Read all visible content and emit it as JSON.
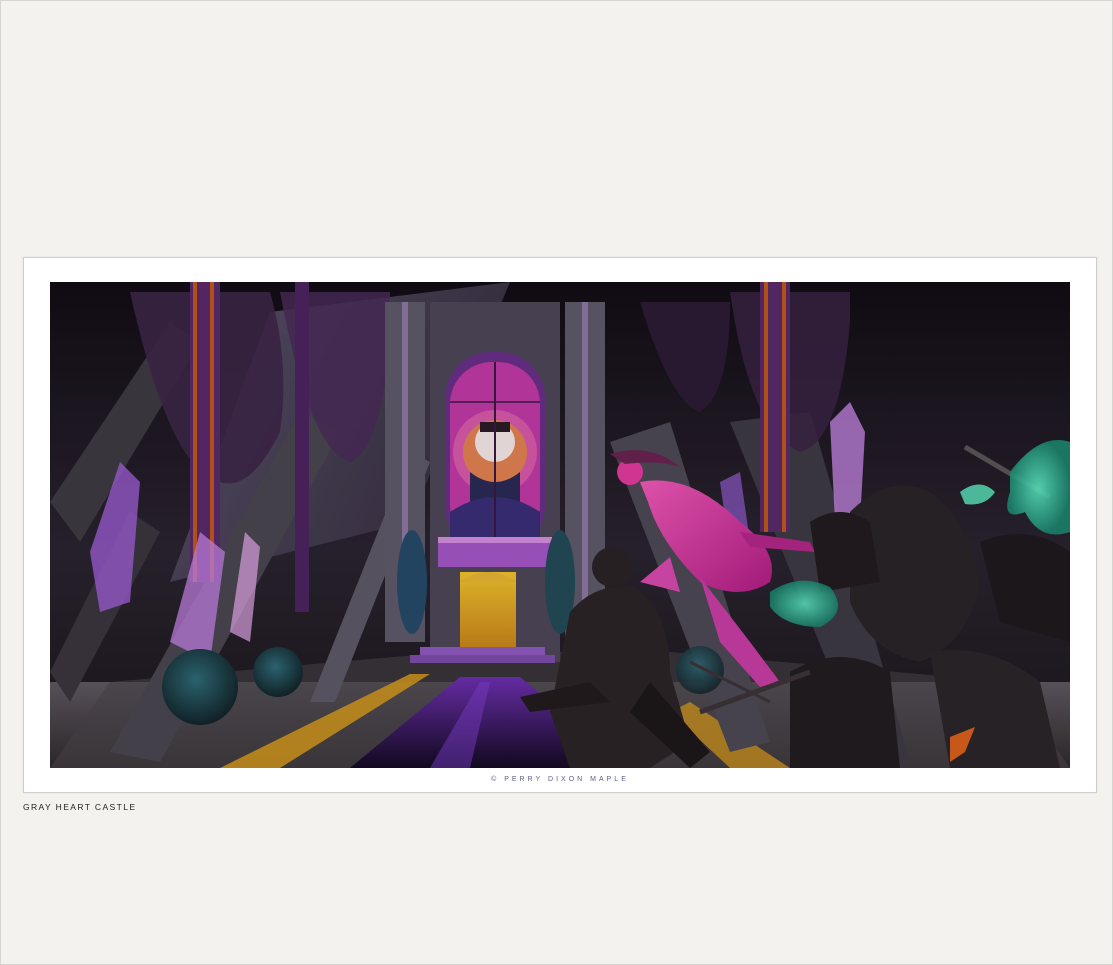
{
  "artwork": {
    "copyright": "© PERRY DIXON MAPLE"
  },
  "caption": {
    "title": "GRAY HEART CASTLE"
  },
  "colors": {
    "page_background": "#f3f2ee",
    "card_background": "#ffffff",
    "copyright_text": "#5c5d86",
    "caption_text": "#222222",
    "scene_accent_pink": "#e23a9e",
    "scene_accent_purple": "#8a4bd0",
    "scene_accent_gold": "#e0a21a",
    "scene_accent_teal": "#3fd8b0"
  }
}
